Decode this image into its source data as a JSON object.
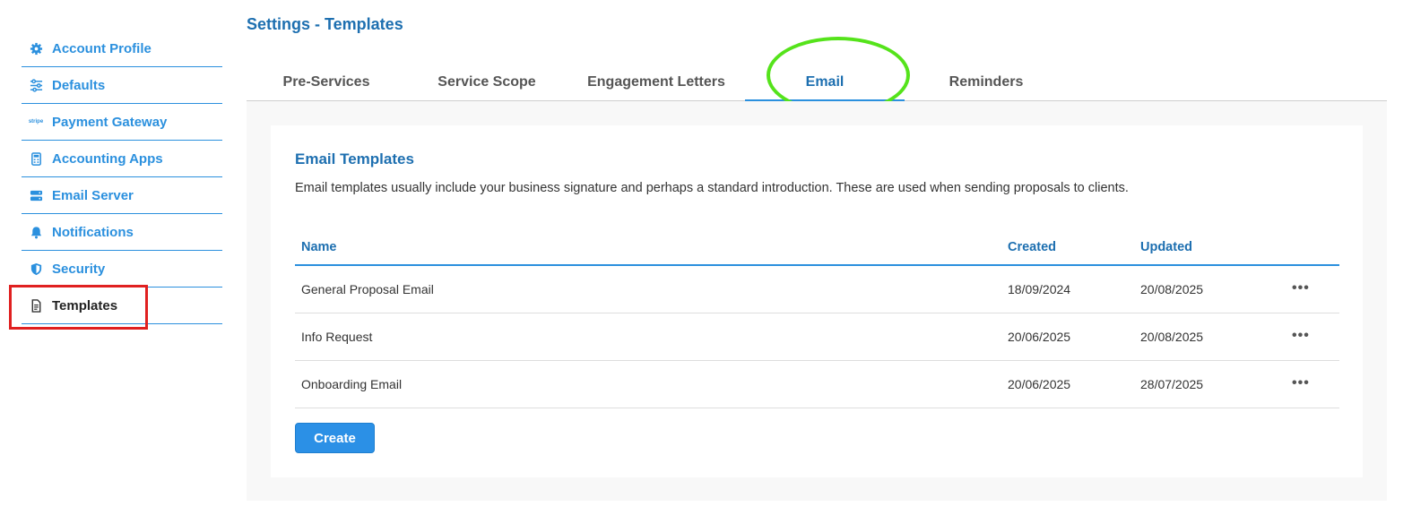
{
  "sidebar": {
    "items": [
      {
        "label": "Account Profile",
        "icon": "gear-icon"
      },
      {
        "label": "Defaults",
        "icon": "sliders-icon"
      },
      {
        "label": "Payment Gateway",
        "icon": "stripe-logo",
        "icon_text": "stripe"
      },
      {
        "label": "Accounting Apps",
        "icon": "calculator-icon"
      },
      {
        "label": "Email Server",
        "icon": "server-icon"
      },
      {
        "label": "Notifications",
        "icon": "bell-icon"
      },
      {
        "label": "Security",
        "icon": "shield-icon"
      },
      {
        "label": "Templates",
        "icon": "document-icon",
        "active": true
      }
    ]
  },
  "header": {
    "title": "Settings - Templates"
  },
  "tabs": [
    {
      "label": "Pre-Services"
    },
    {
      "label": "Service Scope"
    },
    {
      "label": "Engagement Letters"
    },
    {
      "label": "Email",
      "active": true
    },
    {
      "label": "Reminders"
    }
  ],
  "section": {
    "title": "Email Templates",
    "description": "Email templates usually include your business signature and perhaps a standard introduction. These are used when sending proposals to clients."
  },
  "table": {
    "columns": [
      "Name",
      "Created",
      "Updated"
    ],
    "rows": [
      {
        "name": "General Proposal Email",
        "created": "18/09/2024",
        "updated": "20/08/2025",
        "actions": "•••"
      },
      {
        "name": "Info Request",
        "created": "20/06/2025",
        "updated": "20/08/2025",
        "actions": "•••"
      },
      {
        "name": "Onboarding Email",
        "created": "20/06/2025",
        "updated": "28/07/2025",
        "actions": "•••"
      }
    ]
  },
  "create_button": {
    "label": "Create"
  },
  "colors": {
    "accent": "#2b90de",
    "heading": "#1d6fb0",
    "highlight_red": "#e02020",
    "highlight_green": "#55e31b"
  }
}
